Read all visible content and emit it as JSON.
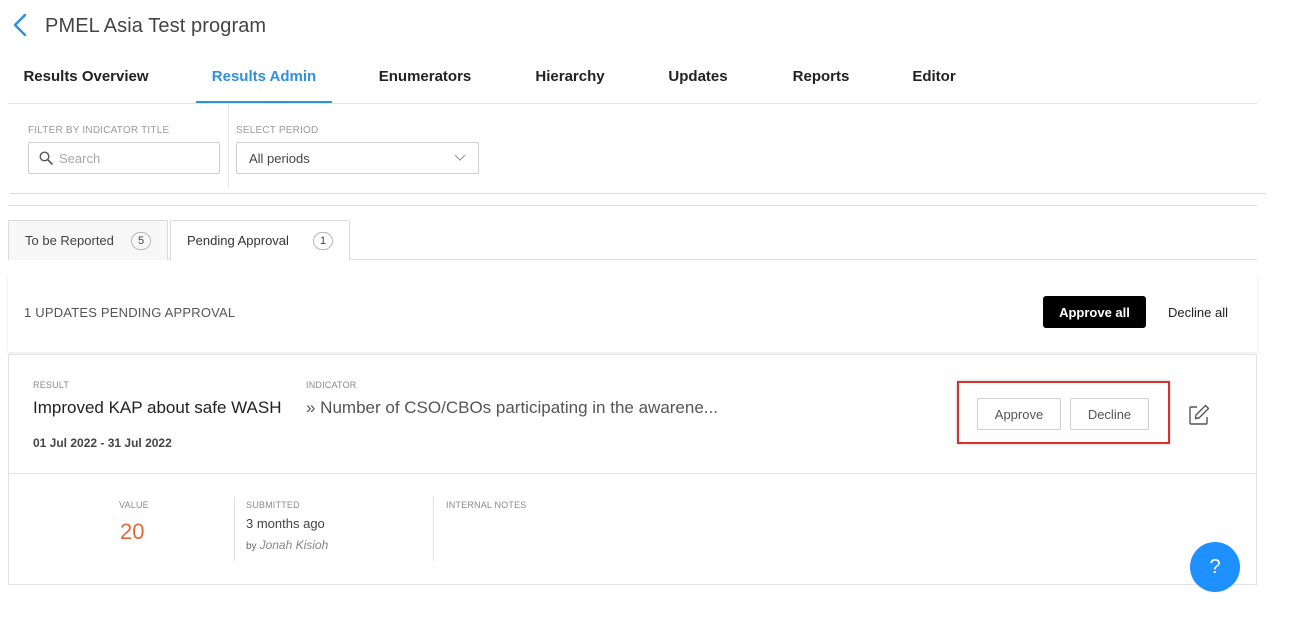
{
  "header": {
    "title": "PMEL Asia Test program"
  },
  "nav": {
    "tabs": [
      {
        "label": "Results Overview",
        "active": false
      },
      {
        "label": "Results Admin",
        "active": true
      },
      {
        "label": "Enumerators",
        "active": false
      },
      {
        "label": "Hierarchy",
        "active": false
      },
      {
        "label": "Updates",
        "active": false
      },
      {
        "label": "Reports",
        "active": false
      },
      {
        "label": "Editor",
        "active": false
      }
    ]
  },
  "filters": {
    "indicator_label": "FILTER BY INDICATOR TITLE",
    "search_placeholder": "Search",
    "search_value": "",
    "period_label": "SELECT PERIOD",
    "period_value": "All periods"
  },
  "subtabs": [
    {
      "label": "To be Reported",
      "count": "5",
      "active": false
    },
    {
      "label": "Pending Approval",
      "count": "1",
      "active": true
    }
  ],
  "pending": {
    "summary": "1 UPDATES PENDING APPROVAL",
    "approve_all": "Approve all",
    "decline_all": "Decline all"
  },
  "update": {
    "result_label": "RESULT",
    "result_title": "Improved KAP about safe WASH",
    "indicator_label": "INDICATOR",
    "indicator_title": "» Number of CSO/CBOs participating in the awarene...",
    "period": "01 Jul 2022 - 31 Jul 2022",
    "approve": "Approve",
    "decline": "Decline",
    "value_label": "VALUE",
    "value": "20",
    "submitted_label": "SUBMITTED",
    "submitted_time": "3 months ago",
    "submitted_by_prefix": "by",
    "submitted_by": "Jonah Kisioh",
    "notes_label": "INTERNAL NOTES"
  },
  "help": {
    "label": "?"
  },
  "colors": {
    "accent": "#2f8fe0",
    "value": "#e06a3a",
    "highlight": "#d8312d",
    "help": "#1e90ff"
  },
  "icons": [
    "chevron-left-icon",
    "search-icon",
    "chevron-down-icon",
    "edit-icon",
    "help-icon"
  ]
}
